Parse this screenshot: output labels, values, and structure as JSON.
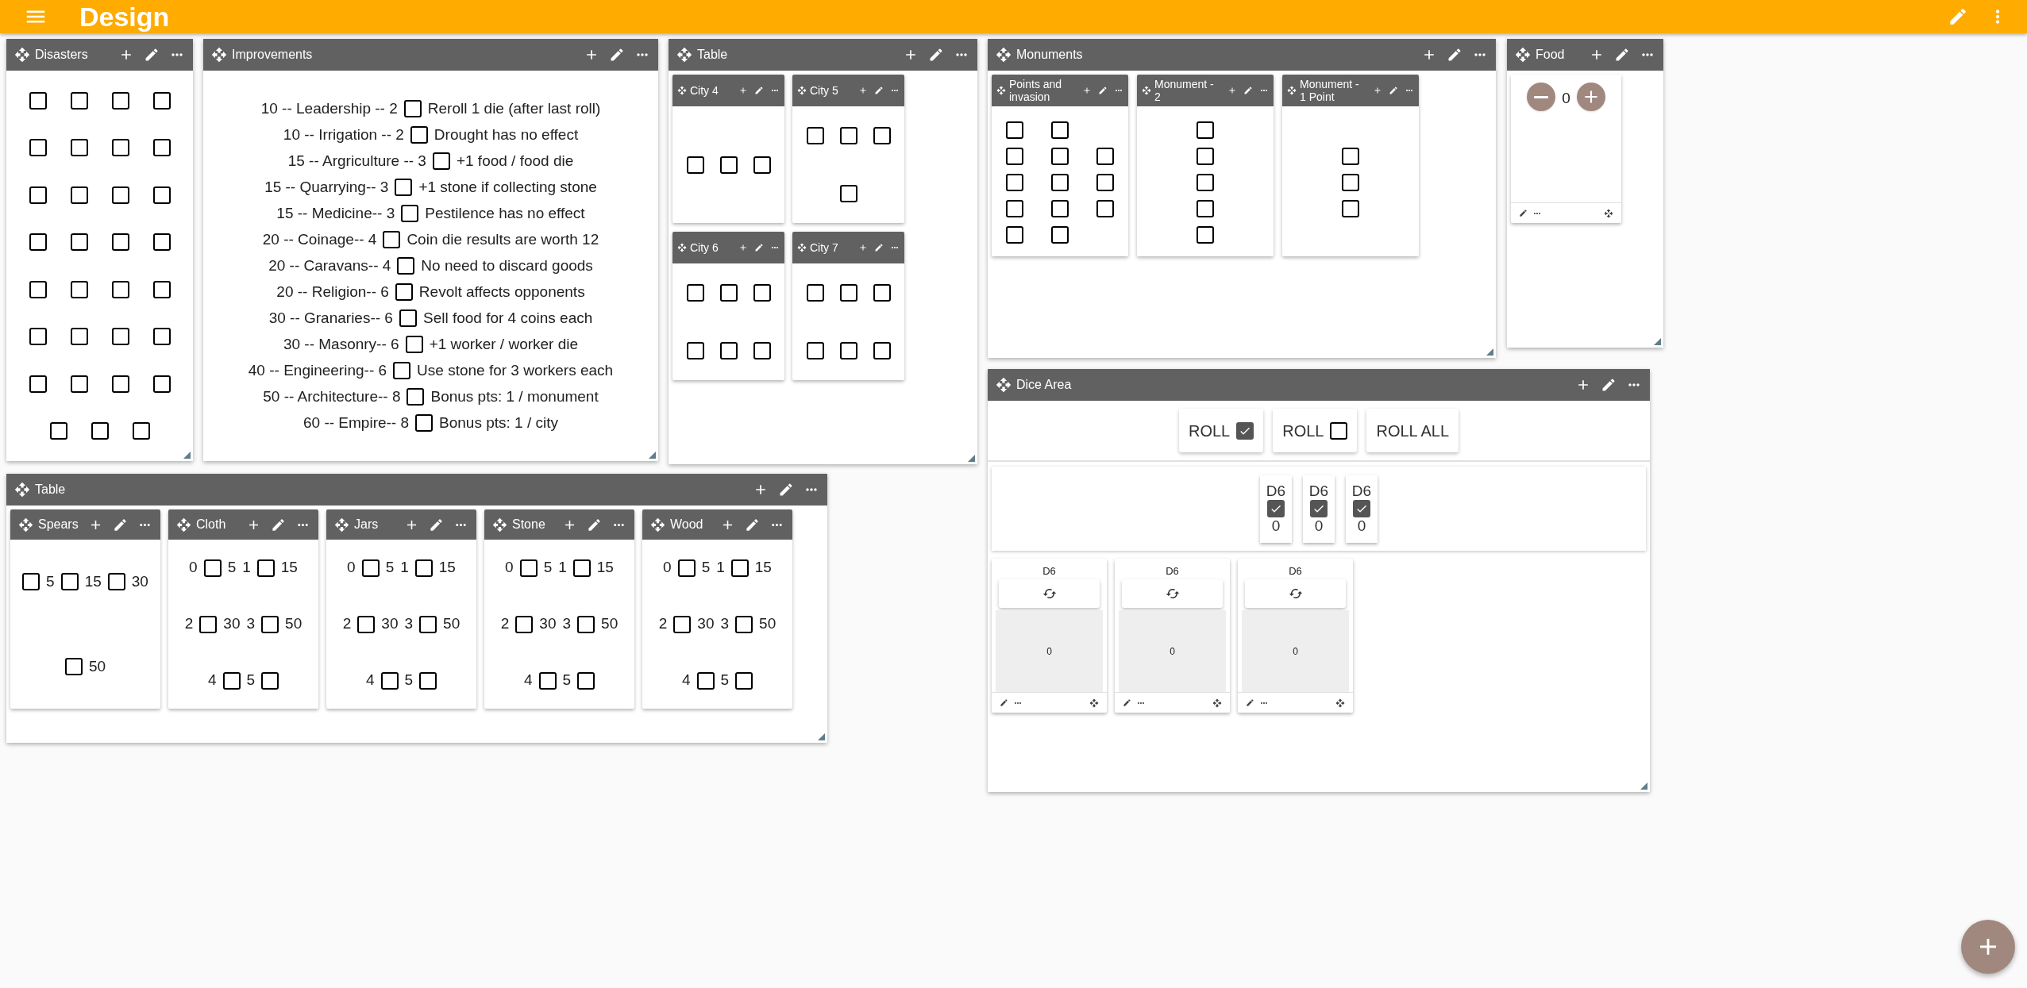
{
  "app_bar": {
    "title": "Design"
  },
  "panels": [
    {
      "kind": "grid",
      "title": "Disasters",
      "rows": [
        [
          {
            "kind": "box",
            "checked": false
          },
          {
            "kind": "box",
            "checked": false
          },
          {
            "kind": "box",
            "checked": false
          },
          {
            "kind": "box",
            "checked": false
          }
        ],
        [
          {
            "kind": "box",
            "checked": false
          },
          {
            "kind": "box",
            "checked": false
          },
          {
            "kind": "box",
            "checked": false
          },
          {
            "kind": "box",
            "checked": false
          }
        ],
        [
          {
            "kind": "box",
            "checked": false
          },
          {
            "kind": "box",
            "checked": false
          },
          {
            "kind": "box",
            "checked": false
          },
          {
            "kind": "box",
            "checked": false
          }
        ],
        [
          {
            "kind": "box",
            "checked": false
          },
          {
            "kind": "box",
            "checked": false
          },
          {
            "kind": "box",
            "checked": false
          },
          {
            "kind": "box",
            "checked": false
          }
        ],
        [
          {
            "kind": "box",
            "checked": false
          },
          {
            "kind": "box",
            "checked": false
          },
          {
            "kind": "box",
            "checked": false
          },
          {
            "kind": "box",
            "checked": false
          }
        ],
        [
          {
            "kind": "box",
            "checked": false
          },
          {
            "kind": "box",
            "checked": false
          },
          {
            "kind": "box",
            "checked": false
          },
          {
            "kind": "box",
            "checked": false
          }
        ],
        [
          {
            "kind": "box",
            "checked": false
          },
          {
            "kind": "box",
            "checked": false
          },
          {
            "kind": "box",
            "checked": false
          },
          {
            "kind": "box",
            "checked": false
          }
        ],
        [
          {
            "kind": "box",
            "checked": false
          },
          {
            "kind": "box",
            "checked": false
          },
          {
            "kind": "box",
            "checked": false
          }
        ]
      ]
    },
    {
      "kind": "lines",
      "title": "Improvements",
      "rows": [
        [
          {
            "kind": "text",
            "text": "10 -- Leadership -- 2"
          },
          {
            "kind": "box",
            "checked": false
          },
          {
            "kind": "text",
            "text": "Reroll 1 die (after last roll)"
          }
        ],
        [
          {
            "kind": "text",
            "text": "10 -- Irrigation -- 2"
          },
          {
            "kind": "box",
            "checked": false
          },
          {
            "kind": "text",
            "text": "Drought has no effect"
          }
        ],
        [
          {
            "kind": "text",
            "text": "15 -- Argriculture -- 3"
          },
          {
            "kind": "box",
            "checked": false
          },
          {
            "kind": "text",
            "text": "+1 food / food die"
          }
        ],
        [
          {
            "kind": "text",
            "text": "15 -- Quarrying-- 3"
          },
          {
            "kind": "box",
            "checked": false
          },
          {
            "kind": "text",
            "text": "+1 stone if collecting stone"
          }
        ],
        [
          {
            "kind": "text",
            "text": "15 -- Medicine-- 3"
          },
          {
            "kind": "box",
            "checked": false
          },
          {
            "kind": "text",
            "text": "Pestilence has no effect"
          }
        ],
        [
          {
            "kind": "text",
            "text": "20 -- Coinage-- 4"
          },
          {
            "kind": "box",
            "checked": false
          },
          {
            "kind": "text",
            "text": "Coin die results are worth 12"
          }
        ],
        [
          {
            "kind": "text",
            "text": "20 -- Caravans-- 4"
          },
          {
            "kind": "box",
            "checked": false
          },
          {
            "kind": "text",
            "text": "No need to discard goods"
          }
        ],
        [
          {
            "kind": "text",
            "text": "20 -- Religion-- 6"
          },
          {
            "kind": "box",
            "checked": false
          },
          {
            "kind": "text",
            "text": "Revolt affects opponents"
          }
        ],
        [
          {
            "kind": "text",
            "text": "30 -- Granaries-- 6"
          },
          {
            "kind": "box",
            "checked": false
          },
          {
            "kind": "text",
            "text": "Sell food for 4 coins each"
          }
        ],
        [
          {
            "kind": "text",
            "text": "30 -- Masonry-- 6"
          },
          {
            "kind": "box",
            "checked": false
          },
          {
            "kind": "text",
            "text": "+1 worker / worker die"
          }
        ],
        [
          {
            "kind": "text",
            "text": "40 -- Engineering-- 6"
          },
          {
            "kind": "box",
            "checked": false
          },
          {
            "kind": "text",
            "text": "Use stone for 3 workers each"
          }
        ],
        [
          {
            "kind": "text",
            "text": "50 -- Architecture-- 8"
          },
          {
            "kind": "box",
            "checked": false
          },
          {
            "kind": "text",
            "text": "Bonus pts: 1 / monument"
          }
        ],
        [
          {
            "kind": "text",
            "text": "60 -- Empire-- 8"
          },
          {
            "kind": "box",
            "checked": false
          },
          {
            "kind": "text",
            "text": "Bonus pts: 1 / city"
          }
        ]
      ]
    },
    {
      "kind": "group",
      "title": "Table",
      "children": [
        {
          "kind": "city",
          "title": "City 4",
          "rows": [
            [
              {
                "kind": "box",
                "checked": false
              },
              {
                "kind": "box",
                "checked": false
              },
              {
                "kind": "box",
                "checked": false
              }
            ]
          ]
        },
        {
          "kind": "city",
          "title": "City 5",
          "rows": [
            [
              {
                "kind": "box",
                "checked": false
              },
              {
                "kind": "box",
                "checked": false
              },
              {
                "kind": "box",
                "checked": false
              }
            ],
            [
              {
                "kind": "box",
                "checked": false
              }
            ]
          ]
        },
        {
          "kind": "city",
          "title": "City 6",
          "rows": [
            [
              {
                "kind": "box",
                "checked": false
              },
              {
                "kind": "box",
                "checked": false
              },
              {
                "kind": "box",
                "checked": false
              }
            ],
            [
              {
                "kind": "box",
                "checked": false
              },
              {
                "kind": "box",
                "checked": false
              },
              {
                "kind": "box",
                "checked": false
              }
            ]
          ]
        },
        {
          "kind": "city",
          "title": "City 7",
          "rows": [
            [
              {
                "kind": "box",
                "checked": false
              },
              {
                "kind": "box",
                "checked": false
              },
              {
                "kind": "box",
                "checked": false
              }
            ],
            [
              {
                "kind": "box",
                "checked": false
              },
              {
                "kind": "box",
                "checked": false
              },
              {
                "kind": "box",
                "checked": false
              }
            ]
          ]
        }
      ]
    },
    {
      "kind": "group",
      "title": "Monuments",
      "children": [
        {
          "kind": "monument",
          "title": "Points and invasion",
          "rows": [
            [
              {
                "kind": "box",
                "checked": false
              },
              {
                "kind": "box",
                "checked": false
              },
              {
                "kind": "blank"
              }
            ],
            [
              {
                "kind": "box",
                "checked": false
              },
              {
                "kind": "box",
                "checked": false
              },
              {
                "kind": "box",
                "checked": false
              }
            ],
            [
              {
                "kind": "box",
                "checked": false
              },
              {
                "kind": "box",
                "checked": false
              },
              {
                "kind": "box",
                "checked": false
              }
            ],
            [
              {
                "kind": "box",
                "checked": false
              },
              {
                "kind": "box",
                "checked": false
              },
              {
                "kind": "box",
                "checked": false
              }
            ],
            [
              {
                "kind": "box",
                "checked": false
              },
              {
                "kind": "box",
                "checked": false
              },
              {
                "kind": "blank"
              }
            ]
          ]
        },
        {
          "kind": "monument",
          "title": "Monument - 2",
          "rows": [
            [
              {
                "kind": "box",
                "checked": false
              }
            ],
            [
              {
                "kind": "box",
                "checked": false
              }
            ],
            [
              {
                "kind": "box",
                "checked": false
              }
            ],
            [
              {
                "kind": "box",
                "checked": false
              }
            ],
            [
              {
                "kind": "box",
                "checked": false
              }
            ]
          ]
        },
        {
          "kind": "monument",
          "title": "Monument - 1 Point",
          "rows": [
            [
              {
                "kind": "blank"
              }
            ],
            [
              {
                "kind": "box",
                "checked": false
              }
            ],
            [
              {
                "kind": "box",
                "checked": false
              }
            ],
            [
              {
                "kind": "box",
                "checked": false
              }
            ]
          ]
        }
      ]
    },
    {
      "kind": "counter",
      "title": "Food",
      "value": "0"
    },
    {
      "kind": "dice",
      "title": "Dice Area",
      "buttons": [
        {
          "kind": "toggle",
          "label": "ROLL",
          "checked": true
        },
        {
          "kind": "toggle",
          "label": "ROLL",
          "checked": false
        },
        {
          "kind": "plain",
          "label": "ROLL ALL"
        }
      ],
      "selected_dice": [
        {
          "label": "D6",
          "checked": true,
          "value": "0"
        },
        {
          "label": "D6",
          "checked": true,
          "value": "0"
        },
        {
          "label": "D6",
          "checked": true,
          "value": "0"
        }
      ],
      "dice": [
        {
          "title": "D6",
          "value": "0"
        },
        {
          "title": "D6",
          "value": "0"
        },
        {
          "title": "D6",
          "value": "0"
        }
      ]
    },
    {
      "kind": "group",
      "title": "Table",
      "children": [
        {
          "kind": "resource",
          "title": "Spears",
          "rows": [
            [
              {
                "kind": "box",
                "checked": false
              },
              {
                "kind": "text",
                "text": "5"
              },
              {
                "kind": "box",
                "checked": false
              },
              {
                "kind": "text",
                "text": "15"
              },
              {
                "kind": "box",
                "checked": false
              },
              {
                "kind": "text",
                "text": "30"
              },
              {
                "kind": "box",
                "checked": false
              },
              {
                "kind": "text",
                "text": "50"
              }
            ]
          ]
        },
        {
          "kind": "resource",
          "title": "Cloth",
          "rows": [
            [
              {
                "kind": "text",
                "text": "0"
              },
              {
                "kind": "box",
                "checked": false
              },
              {
                "kind": "text",
                "text": "5"
              },
              {
                "kind": "text",
                "text": "1"
              },
              {
                "kind": "box",
                "checked": false
              },
              {
                "kind": "text",
                "text": "15"
              }
            ],
            [
              {
                "kind": "text",
                "text": "2"
              },
              {
                "kind": "box",
                "checked": false
              },
              {
                "kind": "text",
                "text": "30"
              },
              {
                "kind": "text",
                "text": "3"
              },
              {
                "kind": "box",
                "checked": false
              },
              {
                "kind": "text",
                "text": "50"
              }
            ],
            [
              {
                "kind": "text",
                "text": "4"
              },
              {
                "kind": "box",
                "checked": false
              },
              {
                "kind": "text",
                "text": "5"
              },
              {
                "kind": "box",
                "checked": false
              }
            ]
          ]
        },
        {
          "kind": "resource",
          "title": "Jars",
          "rows": [
            [
              {
                "kind": "text",
                "text": "0"
              },
              {
                "kind": "box",
                "checked": false
              },
              {
                "kind": "text",
                "text": "5"
              },
              {
                "kind": "text",
                "text": "1"
              },
              {
                "kind": "box",
                "checked": false
              },
              {
                "kind": "text",
                "text": "15"
              }
            ],
            [
              {
                "kind": "text",
                "text": "2"
              },
              {
                "kind": "box",
                "checked": false
              },
              {
                "kind": "text",
                "text": "30"
              },
              {
                "kind": "text",
                "text": "3"
              },
              {
                "kind": "box",
                "checked": false
              },
              {
                "kind": "text",
                "text": "50"
              }
            ],
            [
              {
                "kind": "text",
                "text": "4"
              },
              {
                "kind": "box",
                "checked": false
              },
              {
                "kind": "text",
                "text": "5"
              },
              {
                "kind": "box",
                "checked": false
              }
            ]
          ]
        },
        {
          "kind": "resource",
          "title": "Stone",
          "rows": [
            [
              {
                "kind": "text",
                "text": "0"
              },
              {
                "kind": "box",
                "checked": false
              },
              {
                "kind": "text",
                "text": "5"
              },
              {
                "kind": "text",
                "text": "1"
              },
              {
                "kind": "box",
                "checked": false
              },
              {
                "kind": "text",
                "text": "15"
              }
            ],
            [
              {
                "kind": "text",
                "text": "2"
              },
              {
                "kind": "box",
                "checked": false
              },
              {
                "kind": "text",
                "text": "30"
              },
              {
                "kind": "text",
                "text": "3"
              },
              {
                "kind": "box",
                "checked": false
              },
              {
                "kind": "text",
                "text": "50"
              }
            ],
            [
              {
                "kind": "text",
                "text": "4"
              },
              {
                "kind": "box",
                "checked": false
              },
              {
                "kind": "text",
                "text": "5"
              },
              {
                "kind": "box",
                "checked": false
              }
            ]
          ]
        },
        {
          "kind": "resource",
          "title": "Wood",
          "rows": [
            [
              {
                "kind": "text",
                "text": "0"
              },
              {
                "kind": "box",
                "checked": false
              },
              {
                "kind": "text",
                "text": "5"
              },
              {
                "kind": "text",
                "text": "1"
              },
              {
                "kind": "box",
                "checked": false
              },
              {
                "kind": "text",
                "text": "15"
              }
            ],
            [
              {
                "kind": "text",
                "text": "2"
              },
              {
                "kind": "box",
                "checked": false
              },
              {
                "kind": "text",
                "text": "30"
              },
              {
                "kind": "text",
                "text": "3"
              },
              {
                "kind": "box",
                "checked": false
              },
              {
                "kind": "text",
                "text": "50"
              }
            ],
            [
              {
                "kind": "text",
                "text": "4"
              },
              {
                "kind": "box",
                "checked": false
              },
              {
                "kind": "text",
                "text": "5"
              },
              {
                "kind": "box",
                "checked": false
              }
            ]
          ]
        }
      ]
    }
  ]
}
